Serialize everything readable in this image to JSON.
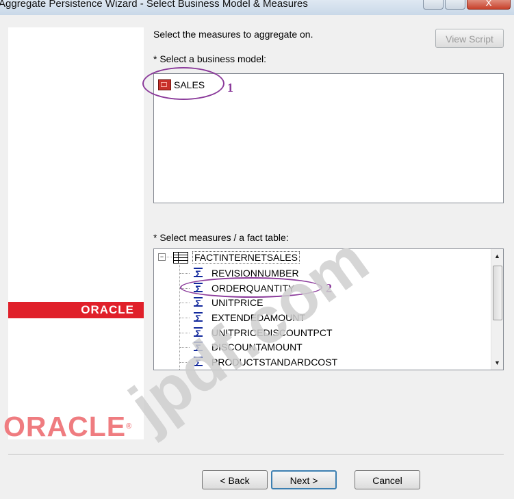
{
  "window": {
    "title": "Aggregate Persistence Wizard - Select Business Model & Measures",
    "close_glyph": "X"
  },
  "branding": {
    "banner_logo": "ORACLE",
    "large_logo": "ORACLE",
    "registered_mark": "®"
  },
  "main": {
    "instruction": "Select the measures to aggregate on.",
    "view_script_label": "View Script",
    "business_model_label": "* Select a business model:",
    "business_models": [
      {
        "label": "SALES",
        "icon": "business-model-cube-icon"
      }
    ],
    "measures_label": "* Select measures / a fact table:",
    "fact_table": {
      "label": "FACTINTERNETSALES",
      "expander": "−",
      "measures": [
        {
          "label": "REVISIONNUMBER"
        },
        {
          "label": "ORDERQUANTITY"
        },
        {
          "label": "UNITPRICE"
        },
        {
          "label": "EXTENDEDAMOUNT"
        },
        {
          "label": "UNITPRICEDISCOUNTPCT"
        },
        {
          "label": "DISCOUNTAMOUNT"
        },
        {
          "label": "PRODUCTSTANDARDCOST"
        }
      ]
    }
  },
  "annotations": {
    "marker_1": "1",
    "marker_2": "2",
    "color": "#8b3b9b"
  },
  "watermark": "jpdf.com",
  "footer": {
    "back_label": "< Back",
    "next_label": "Next >",
    "cancel_label": "Cancel"
  },
  "colors": {
    "oracle_red": "#e0202a",
    "oracle_logo_faded": "#ef7c80",
    "dialog_bg": "#f0f0f0"
  }
}
